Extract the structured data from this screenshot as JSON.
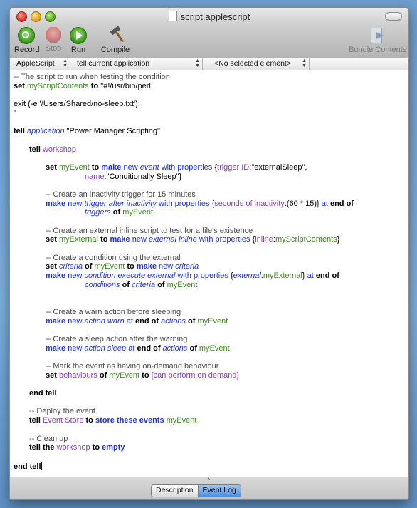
{
  "window": {
    "title": "script.applescript"
  },
  "toolbar": {
    "record": "Record",
    "stop": "Stop",
    "run": "Run",
    "compile": "Compile",
    "bundle": "Bundle Contents"
  },
  "navbar": {
    "language": "AppleScript",
    "target": "tell current application",
    "element": "<No selected element>"
  },
  "code": {
    "c1": "-- The script to run when testing the condition",
    "l2_set": "set",
    "l2_var": "myScriptContents",
    "l2_to": "to",
    "l2_str": "\"#!/usr/bin/perl",
    "l4": "exit (-e '/Users/Shared/no-sleep.txt');",
    "l5": "\"",
    "l7_tell": "tell",
    "l7_app": "application",
    "l7_str": "\"Power Manager Scripting\"",
    "l9_tell": "tell",
    "l9_obj": "workshop",
    "l11_set": "set",
    "l11_var": "myEvent",
    "l11_to": "to",
    "l11_make": "make",
    "l11_new": "new",
    "l11_cls": "event",
    "l11_with": "with properties",
    "l11_b": "{",
    "l11_p1": "trigger ID",
    "l11_v1": ":\"externalSleep\",",
    "l12_p": "name",
    "l12_v": ":\"Conditionally Sleep\"}",
    "c14": "-- Create an inactivity trigger for 15 minutes",
    "l15_make": "make",
    "l15_new": "new",
    "l15_cls": "trigger after inactivity",
    "l15_with": "with properties",
    "l15_b": "{",
    "l15_p": "seconds of inactivity",
    "l15_v": ":(60 * 15)}",
    "l15_at": "at",
    "l15_end": "end of",
    "l16_cls": "triggers",
    "l16_of": "of",
    "l16_var": "myEvent",
    "c18": "-- Create an external inline script to test for a file's existence",
    "l19_set": "set",
    "l19_var": "myExternal",
    "l19_to": "to",
    "l19_make": "make",
    "l19_new": "new",
    "l19_cls": "external inline",
    "l19_with": "with properties",
    "l19_b": "{",
    "l19_p": "inline",
    "l19_c": ":",
    "l19_v": "myScriptContents",
    "l19_e": "}",
    "c21": "-- Create a condition using the external",
    "l22_set": "set",
    "l22_cls": "criteria",
    "l22_of": "of",
    "l22_var": "myEvent",
    "l22_to": "to",
    "l22_make": "make",
    "l22_new": "new",
    "l22_cls2": "criteria",
    "l23_make": "make",
    "l23_new": "new",
    "l23_cls": "condition execute external",
    "l23_with": "with properties",
    "l23_b": "{",
    "l23_p": "external",
    "l23_c": ":",
    "l23_v": "myExternal",
    "l23_e": "}",
    "l23_at": "at",
    "l23_end": "end of",
    "l24_cls": "conditions",
    "l24_of": "of",
    "l24_cls2": "criteria",
    "l24_of2": "of",
    "l24_var": "myEvent",
    "c27": "-- Create a warn action before sleeping",
    "l28_make": "make",
    "l28_new": "new",
    "l28_cls": "action warn",
    "l28_at": "at",
    "l28_end": "end of",
    "l28_cls2": "actions",
    "l28_of": "of",
    "l28_var": "myEvent",
    "c30": "-- Create a sleep action after the warning",
    "l31_make": "make",
    "l31_new": "new",
    "l31_cls": "action sleep",
    "l31_at": "at",
    "l31_end": "end of",
    "l31_cls2": "actions",
    "l31_of": "of",
    "l31_var": "myEvent",
    "c33": "-- Mark the event as having on-demand behaviour",
    "l34_set": "set",
    "l34_p": "behaviours",
    "l34_of": "of",
    "l34_var": "myEvent",
    "l34_to": "to",
    "l34_v": "[can perform on demand]",
    "l36": "end tell",
    "c38": "-- Deploy the event",
    "l39_tell": "tell",
    "l39_obj": "Event Store",
    "l39_to": "to",
    "l39_cmd": "store these events",
    "l39_var": "myEvent",
    "c41": "-- Clean up",
    "l42_tell": "tell the",
    "l42_obj": "workshop",
    "l42_to": "to",
    "l42_cmd": "empty",
    "l44": "end tell"
  },
  "bottom": {
    "tab_description": "Description",
    "tab_event_log": "Event Log",
    "active_tab": "Event Log"
  },
  "colors": {
    "keyword_blue": "#1f33d6",
    "property_purple": "#8a3fb2",
    "variable_green": "#3e8a1f",
    "comment_gray": "#4c4c4c"
  }
}
